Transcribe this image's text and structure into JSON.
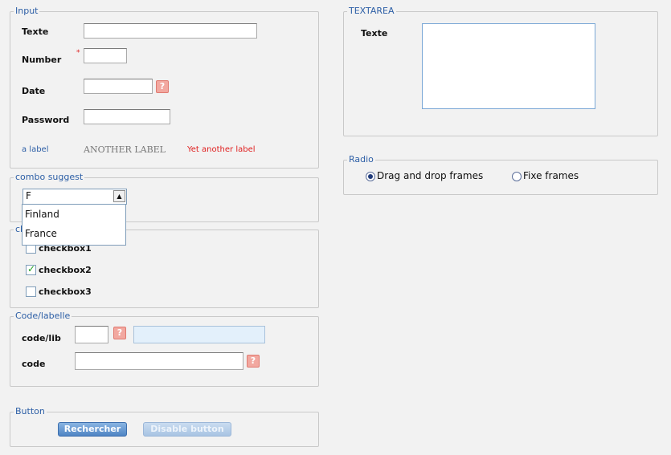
{
  "input": {
    "legend": "Input",
    "texte_label": "Texte",
    "number_label": "Number",
    "number_required": "*",
    "date_label": "Date",
    "date_help": "?",
    "password_label": "Password",
    "a_label": "a label",
    "another_label": "ANOTHER LABEL",
    "yet_another_label": "Yet another label"
  },
  "combo": {
    "legend": "combo suggest",
    "value": "F",
    "options": [
      "Finland",
      "France"
    ]
  },
  "checkboxes": {
    "legend": "cb",
    "items": [
      {
        "label": "checkbox1",
        "checked": false
      },
      {
        "label": "checkbox2",
        "checked": true
      },
      {
        "label": "checkbox3",
        "checked": false
      }
    ]
  },
  "codelib": {
    "legend": "Code/labelle",
    "codelib_label": "code/lib",
    "code_label": "code",
    "help": "?"
  },
  "buttons": {
    "legend": "Button",
    "search_label": "Rechercher",
    "disabled_label": "Disable button"
  },
  "textarea": {
    "legend": "TEXTAREA",
    "texte_label": "Texte"
  },
  "radio": {
    "legend": "Radio",
    "options": [
      {
        "label": "Drag and drop frames",
        "selected": true
      },
      {
        "label": "Fixe frames",
        "selected": false
      }
    ]
  },
  "colors": {
    "legend": "#2d5fa6",
    "label_red": "#e02020",
    "help_bg": "#f2a8a0",
    "button_primary": "#4f84c4"
  }
}
